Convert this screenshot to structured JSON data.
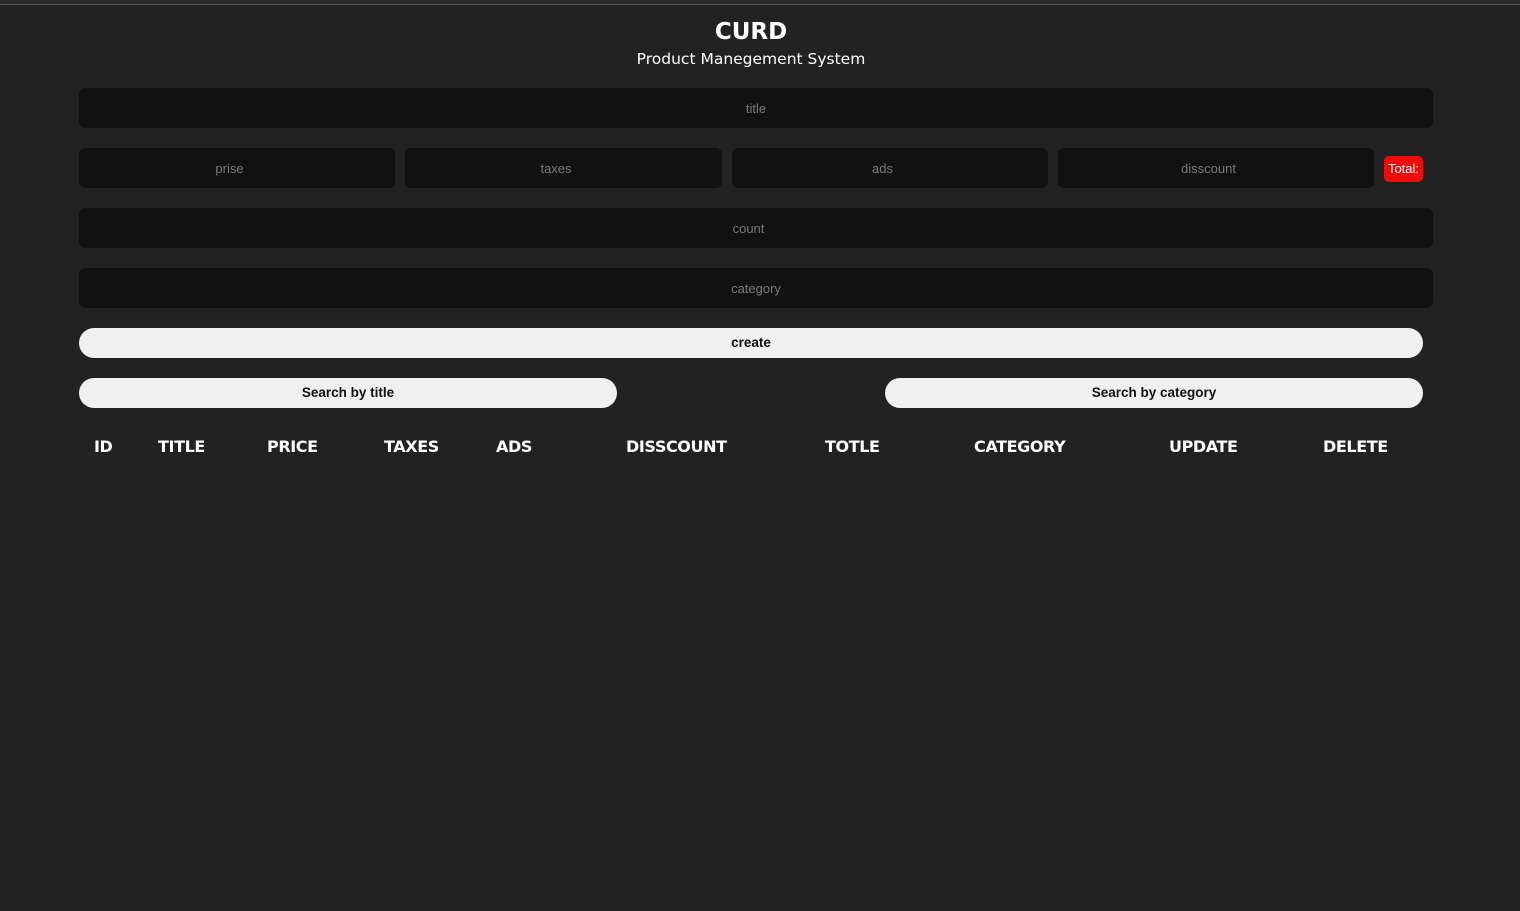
{
  "header": {
    "title": "CURD",
    "subtitle": "Product Manegement System"
  },
  "form": {
    "title_placeholder": "title",
    "price_placeholder": "prise",
    "taxes_placeholder": "taxes",
    "ads_placeholder": "ads",
    "discount_placeholder": "disscount",
    "total_label": "Total:",
    "count_placeholder": "count",
    "category_placeholder": "category",
    "create_label": "create"
  },
  "search": {
    "by_title_label": "Search by title",
    "by_category_label": "Search by category"
  },
  "table": {
    "columns": [
      "ID",
      "TITLE",
      "PRICE",
      "TAXES",
      "ADS",
      "DISSCOUNT",
      "TOTLE",
      "CATEGORY",
      "UPDATE",
      "DELETE"
    ],
    "rows": []
  },
  "colors": {
    "background": "#222222",
    "input_background": "#111111",
    "button_background": "#f0f0f0",
    "total_badge": "#f00b0b"
  }
}
